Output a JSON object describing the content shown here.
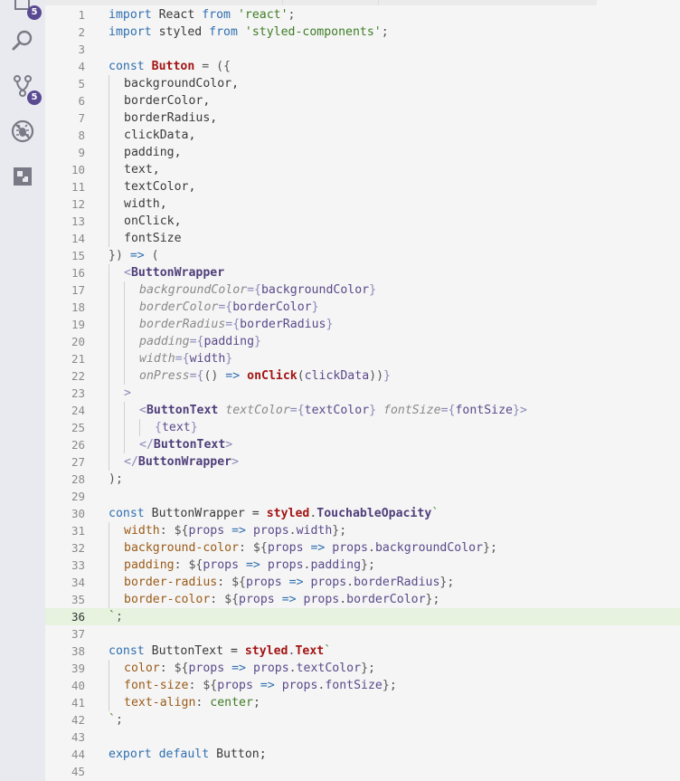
{
  "activity_bar": {
    "items": [
      {
        "name": "explorer",
        "icon": "files-icon",
        "badge": "5"
      },
      {
        "name": "search",
        "icon": "search-icon"
      },
      {
        "name": "source-control",
        "icon": "source-control-icon",
        "badge": "5"
      },
      {
        "name": "debug",
        "icon": "debug-icon"
      },
      {
        "name": "extensions",
        "icon": "extensions-icon"
      }
    ]
  },
  "editor": {
    "current_line": 36,
    "lines": [
      {
        "n": "1",
        "indent": 0,
        "tokens": [
          {
            "t": "import",
            "c": "kw"
          },
          {
            "t": " React ",
            "c": "plain"
          },
          {
            "t": "from",
            "c": "kw"
          },
          {
            "t": " ",
            "c": "plain"
          },
          {
            "t": "'react'",
            "c": "str"
          },
          {
            "t": ";",
            "c": "punc"
          }
        ]
      },
      {
        "n": "2",
        "indent": 0,
        "tokens": [
          {
            "t": "import",
            "c": "kw"
          },
          {
            "t": " styled ",
            "c": "plain"
          },
          {
            "t": "from",
            "c": "kw"
          },
          {
            "t": " ",
            "c": "plain"
          },
          {
            "t": "'styled-components'",
            "c": "str"
          },
          {
            "t": ";",
            "c": "punc"
          }
        ]
      },
      {
        "n": "3",
        "indent": 0,
        "tokens": []
      },
      {
        "n": "4",
        "indent": 0,
        "tokens": [
          {
            "t": "const",
            "c": "kw"
          },
          {
            "t": " ",
            "c": "plain"
          },
          {
            "t": "Button",
            "c": "def"
          },
          {
            "t": " = ({",
            "c": "punc"
          }
        ]
      },
      {
        "n": "5",
        "indent": 1,
        "tokens": [
          {
            "t": "backgroundColor,",
            "c": "plain"
          }
        ]
      },
      {
        "n": "6",
        "indent": 1,
        "tokens": [
          {
            "t": "borderColor,",
            "c": "plain"
          }
        ]
      },
      {
        "n": "7",
        "indent": 1,
        "tokens": [
          {
            "t": "borderRadius,",
            "c": "plain"
          }
        ]
      },
      {
        "n": "8",
        "indent": 1,
        "tokens": [
          {
            "t": "clickData,",
            "c": "plain"
          }
        ]
      },
      {
        "n": "9",
        "indent": 1,
        "tokens": [
          {
            "t": "padding,",
            "c": "plain"
          }
        ]
      },
      {
        "n": "10",
        "indent": 1,
        "tokens": [
          {
            "t": "text,",
            "c": "plain"
          }
        ]
      },
      {
        "n": "11",
        "indent": 1,
        "tokens": [
          {
            "t": "textColor,",
            "c": "plain"
          }
        ]
      },
      {
        "n": "12",
        "indent": 1,
        "tokens": [
          {
            "t": "width,",
            "c": "plain"
          }
        ]
      },
      {
        "n": "13",
        "indent": 1,
        "tokens": [
          {
            "t": "onClick,",
            "c": "plain"
          }
        ]
      },
      {
        "n": "14",
        "indent": 1,
        "tokens": [
          {
            "t": "fontSize",
            "c": "plain"
          }
        ]
      },
      {
        "n": "15",
        "indent": 0,
        "tokens": [
          {
            "t": "}) ",
            "c": "punc"
          },
          {
            "t": "=>",
            "c": "kw"
          },
          {
            "t": " (",
            "c": "punc"
          }
        ]
      },
      {
        "n": "16",
        "indent": 1,
        "tokens": [
          {
            "t": "<",
            "c": "br"
          },
          {
            "t": "ButtonWrapper",
            "c": "tag"
          }
        ]
      },
      {
        "n": "17",
        "indent": 2,
        "tokens": [
          {
            "t": "backgroundColor",
            "c": "attr"
          },
          {
            "t": "={",
            "c": "br"
          },
          {
            "t": "backgroundColor",
            "c": "var"
          },
          {
            "t": "}",
            "c": "br"
          }
        ]
      },
      {
        "n": "18",
        "indent": 2,
        "tokens": [
          {
            "t": "borderColor",
            "c": "attr"
          },
          {
            "t": "={",
            "c": "br"
          },
          {
            "t": "borderColor",
            "c": "var"
          },
          {
            "t": "}",
            "c": "br"
          }
        ]
      },
      {
        "n": "19",
        "indent": 2,
        "tokens": [
          {
            "t": "borderRadius",
            "c": "attr"
          },
          {
            "t": "={",
            "c": "br"
          },
          {
            "t": "borderRadius",
            "c": "var"
          },
          {
            "t": "}",
            "c": "br"
          }
        ]
      },
      {
        "n": "20",
        "indent": 2,
        "tokens": [
          {
            "t": "padding",
            "c": "attr"
          },
          {
            "t": "={",
            "c": "br"
          },
          {
            "t": "padding",
            "c": "var"
          },
          {
            "t": "}",
            "c": "br"
          }
        ]
      },
      {
        "n": "21",
        "indent": 2,
        "tokens": [
          {
            "t": "width",
            "c": "attr"
          },
          {
            "t": "={",
            "c": "br"
          },
          {
            "t": "width",
            "c": "var"
          },
          {
            "t": "}",
            "c": "br"
          }
        ]
      },
      {
        "n": "22",
        "indent": 2,
        "tokens": [
          {
            "t": "onPress",
            "c": "attr"
          },
          {
            "t": "={",
            "c": "br"
          },
          {
            "t": "() ",
            "c": "punc"
          },
          {
            "t": "=>",
            "c": "kw"
          },
          {
            "t": " ",
            "c": "plain"
          },
          {
            "t": "onClick",
            "c": "fn"
          },
          {
            "t": "(",
            "c": "punc"
          },
          {
            "t": "clickData",
            "c": "var"
          },
          {
            "t": "))",
            "c": "punc"
          },
          {
            "t": "}",
            "c": "br"
          }
        ]
      },
      {
        "n": "23",
        "indent": 1,
        "tokens": [
          {
            "t": ">",
            "c": "br"
          }
        ]
      },
      {
        "n": "24",
        "indent": 2,
        "tokens": [
          {
            "t": "<",
            "c": "br"
          },
          {
            "t": "ButtonText",
            "c": "tag"
          },
          {
            "t": " ",
            "c": "plain"
          },
          {
            "t": "textColor",
            "c": "attr"
          },
          {
            "t": "={",
            "c": "br"
          },
          {
            "t": "textColor",
            "c": "var"
          },
          {
            "t": "}",
            "c": "br"
          },
          {
            "t": " ",
            "c": "plain"
          },
          {
            "t": "fontSize",
            "c": "attr"
          },
          {
            "t": "={",
            "c": "br"
          },
          {
            "t": "fontSize",
            "c": "var"
          },
          {
            "t": "}>",
            "c": "br"
          }
        ]
      },
      {
        "n": "25",
        "indent": 3,
        "tokens": [
          {
            "t": "{",
            "c": "br"
          },
          {
            "t": "text",
            "c": "var"
          },
          {
            "t": "}",
            "c": "br"
          }
        ]
      },
      {
        "n": "26",
        "indent": 2,
        "tokens": [
          {
            "t": "</",
            "c": "br"
          },
          {
            "t": "ButtonText",
            "c": "tag"
          },
          {
            "t": ">",
            "c": "br"
          }
        ]
      },
      {
        "n": "27",
        "indent": 1,
        "tokens": [
          {
            "t": "</",
            "c": "br"
          },
          {
            "t": "ButtonWrapper",
            "c": "tag"
          },
          {
            "t": ">",
            "c": "br"
          }
        ]
      },
      {
        "n": "28",
        "indent": 0,
        "tokens": [
          {
            "t": ");",
            "c": "punc"
          }
        ]
      },
      {
        "n": "29",
        "indent": 0,
        "tokens": []
      },
      {
        "n": "30",
        "indent": 0,
        "tokens": [
          {
            "t": "const",
            "c": "kw"
          },
          {
            "t": " ButtonWrapper = ",
            "c": "plain"
          },
          {
            "t": "styled",
            "c": "sty"
          },
          {
            "t": ".",
            "c": "punc"
          },
          {
            "t": "TouchableOpacity",
            "c": "tag"
          },
          {
            "t": "`",
            "c": "str"
          }
        ]
      },
      {
        "n": "31",
        "indent": 1,
        "tokens": [
          {
            "t": "width",
            "c": "css"
          },
          {
            "t": ": ${",
            "c": "punc"
          },
          {
            "t": "props",
            "c": "var"
          },
          {
            "t": " => ",
            "c": "kw"
          },
          {
            "t": "props",
            "c": "var"
          },
          {
            "t": ".",
            "c": "punc"
          },
          {
            "t": "width",
            "c": "var"
          },
          {
            "t": "};",
            "c": "punc"
          }
        ]
      },
      {
        "n": "32",
        "indent": 1,
        "tokens": [
          {
            "t": "background-color",
            "c": "css"
          },
          {
            "t": ": ${",
            "c": "punc"
          },
          {
            "t": "props",
            "c": "var"
          },
          {
            "t": " => ",
            "c": "kw"
          },
          {
            "t": "props",
            "c": "var"
          },
          {
            "t": ".",
            "c": "punc"
          },
          {
            "t": "backgroundColor",
            "c": "var"
          },
          {
            "t": "};",
            "c": "punc"
          }
        ]
      },
      {
        "n": "33",
        "indent": 1,
        "tokens": [
          {
            "t": "padding",
            "c": "css"
          },
          {
            "t": ": ${",
            "c": "punc"
          },
          {
            "t": "props",
            "c": "var"
          },
          {
            "t": " => ",
            "c": "kw"
          },
          {
            "t": "props",
            "c": "var"
          },
          {
            "t": ".",
            "c": "punc"
          },
          {
            "t": "padding",
            "c": "var"
          },
          {
            "t": "};",
            "c": "punc"
          }
        ]
      },
      {
        "n": "34",
        "indent": 1,
        "tokens": [
          {
            "t": "border-radius",
            "c": "css"
          },
          {
            "t": ": ${",
            "c": "punc"
          },
          {
            "t": "props",
            "c": "var"
          },
          {
            "t": " => ",
            "c": "kw"
          },
          {
            "t": "props",
            "c": "var"
          },
          {
            "t": ".",
            "c": "punc"
          },
          {
            "t": "borderRadius",
            "c": "var"
          },
          {
            "t": "};",
            "c": "punc"
          }
        ]
      },
      {
        "n": "35",
        "indent": 1,
        "tokens": [
          {
            "t": "border-color",
            "c": "css"
          },
          {
            "t": ": ${",
            "c": "punc"
          },
          {
            "t": "props",
            "c": "var"
          },
          {
            "t": " => ",
            "c": "kw"
          },
          {
            "t": "props",
            "c": "var"
          },
          {
            "t": ".",
            "c": "punc"
          },
          {
            "t": "borderColor",
            "c": "var"
          },
          {
            "t": "};",
            "c": "punc"
          }
        ]
      },
      {
        "n": "36",
        "indent": 0,
        "tokens": [
          {
            "t": "`",
            "c": "str"
          },
          {
            "t": ";",
            "c": "punc"
          }
        ]
      },
      {
        "n": "37",
        "indent": 0,
        "tokens": []
      },
      {
        "n": "38",
        "indent": 0,
        "tokens": [
          {
            "t": "const",
            "c": "kw"
          },
          {
            "t": " ButtonText = ",
            "c": "plain"
          },
          {
            "t": "styled",
            "c": "sty"
          },
          {
            "t": ".",
            "c": "punc"
          },
          {
            "t": "Text",
            "c": "sty"
          },
          {
            "t": "`",
            "c": "str"
          }
        ]
      },
      {
        "n": "39",
        "indent": 1,
        "tokens": [
          {
            "t": "color",
            "c": "css"
          },
          {
            "t": ": ${",
            "c": "punc"
          },
          {
            "t": "props",
            "c": "var"
          },
          {
            "t": " => ",
            "c": "kw"
          },
          {
            "t": "props",
            "c": "var"
          },
          {
            "t": ".",
            "c": "punc"
          },
          {
            "t": "textColor",
            "c": "var"
          },
          {
            "t": "};",
            "c": "punc"
          }
        ]
      },
      {
        "n": "40",
        "indent": 1,
        "tokens": [
          {
            "t": "font-size",
            "c": "css"
          },
          {
            "t": ": ${",
            "c": "punc"
          },
          {
            "t": "props",
            "c": "var"
          },
          {
            "t": " => ",
            "c": "kw"
          },
          {
            "t": "props",
            "c": "var"
          },
          {
            "t": ".",
            "c": "punc"
          },
          {
            "t": "fontSize",
            "c": "var"
          },
          {
            "t": "};",
            "c": "punc"
          }
        ]
      },
      {
        "n": "41",
        "indent": 1,
        "tokens": [
          {
            "t": "text-align",
            "c": "css"
          },
          {
            "t": ": ",
            "c": "punc"
          },
          {
            "t": "center",
            "c": "val"
          },
          {
            "t": ";",
            "c": "punc"
          }
        ]
      },
      {
        "n": "42",
        "indent": 0,
        "tokens": [
          {
            "t": "`",
            "c": "str"
          },
          {
            "t": ";",
            "c": "punc"
          }
        ]
      },
      {
        "n": "43",
        "indent": 0,
        "tokens": []
      },
      {
        "n": "44",
        "indent": 0,
        "tokens": [
          {
            "t": "export",
            "c": "kw"
          },
          {
            "t": " ",
            "c": "plain"
          },
          {
            "t": "default",
            "c": "kw"
          },
          {
            "t": " Button;",
            "c": "plain"
          }
        ]
      },
      {
        "n": "45",
        "indent": 0,
        "tokens": []
      }
    ]
  }
}
